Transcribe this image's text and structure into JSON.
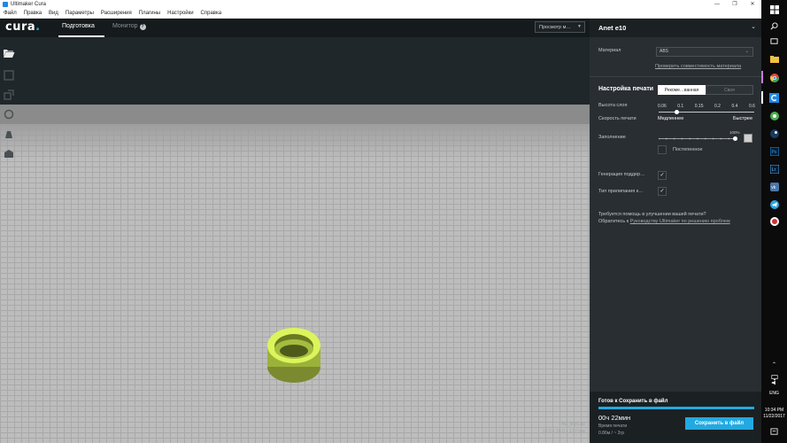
{
  "window": {
    "title": "Ultimaker Cura",
    "controls": [
      "—",
      "❐",
      "✕"
    ]
  },
  "menu": [
    "Файл",
    "Правка",
    "Вид",
    "Параметры",
    "Расширения",
    "Плагины",
    "Настройки",
    "Справка"
  ],
  "header": {
    "logo": "cura",
    "logo_dot": ".",
    "tabs": [
      {
        "label": "Подготовка"
      },
      {
        "label": "Монитор"
      }
    ],
    "help_glyph": "?",
    "view_select": "Просмотр м…"
  },
  "viewport": {
    "model_name": "AE_dripCap",
    "model_dims": "18.0 x 18.0 x 17.0 мм"
  },
  "panel": {
    "printer": "Anet e10",
    "material_label": "Материал",
    "material_value": "ABS",
    "compat_link": "Проверить совместимость материала",
    "settings_title": "Настройка печати",
    "mode_recommended": "Рекоме…ванная",
    "mode_custom": "Своя",
    "layer_height_label": "Высота слоя",
    "layer_heights": [
      "0.06",
      "0.1",
      "0.15",
      "0.2",
      "0.4",
      "0.6"
    ],
    "print_speed_label": "Скорость печати",
    "slow": "Медленнее",
    "fast": "Быстрее",
    "infill_label": "Заполнение",
    "infill_percent": "100%",
    "gradual_label": "Постепенное",
    "support_label": "Генерация поддер…",
    "adhesion_label": "Тип прилипания к…",
    "check_glyph": "✓",
    "help_line1": "Требуется помощь в улучшении вашей печати?",
    "help_line2": "Обратитесь к ",
    "help_link": "Руководству Ultimaker по решению проблем"
  },
  "save": {
    "title": "Готов к Сохранить в файл",
    "progress": 1.0,
    "time": "00ч 22мин",
    "time_label": "Время печати",
    "material_usage": "0.86м / ~ 2гр",
    "button": "Сохранить в файл"
  },
  "taskbar": {
    "lang": "ENG",
    "time": "10:34 PM",
    "date": "11/22/2017"
  },
  "colors": {
    "accent": "#23a9e1",
    "model": "#dcf45c",
    "panel_bg": "#292e32",
    "header_bg": "#151a1d"
  }
}
